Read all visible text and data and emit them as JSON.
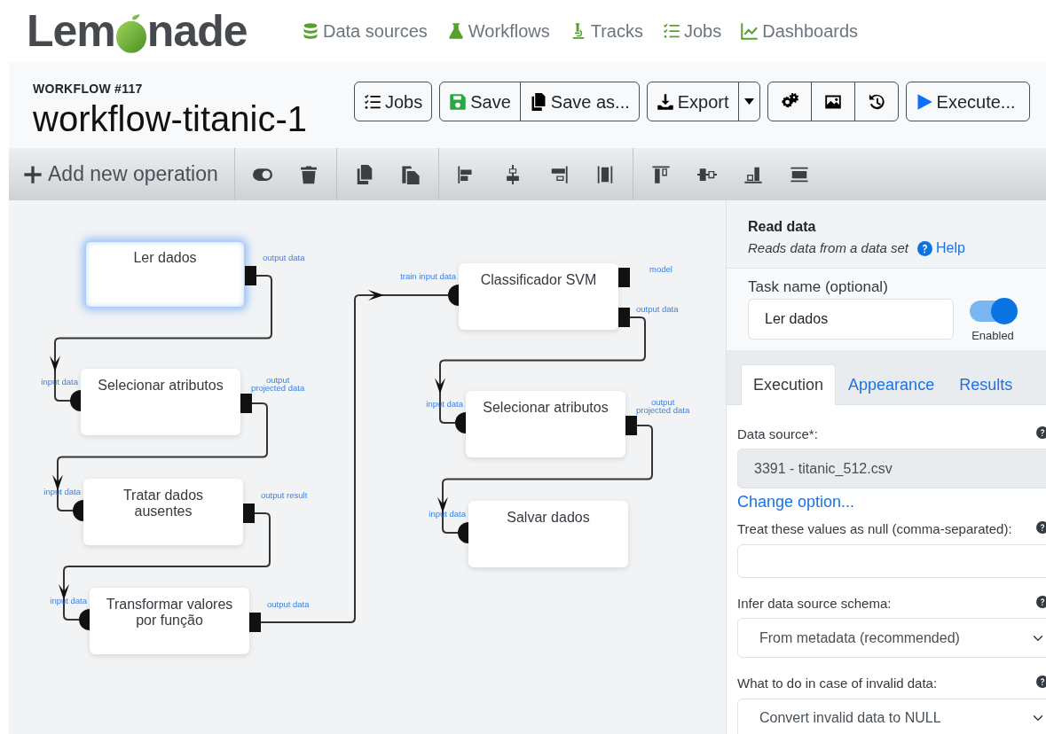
{
  "logo": {
    "before": "Lem",
    "after": "nade"
  },
  "nav": [
    {
      "label": "Data sources"
    },
    {
      "label": "Workflows"
    },
    {
      "label": "Tracks"
    },
    {
      "label": "Jobs"
    },
    {
      "label": "Dashboards"
    }
  ],
  "workflow": {
    "number": "WORKFLOW #117",
    "title": "workflow-titanic-1"
  },
  "button_groups": [
    [
      {
        "kind": "text",
        "label": "Jobs"
      }
    ],
    [
      {
        "kind": "text",
        "label": "Save"
      },
      {
        "kind": "text",
        "label": "Save as..."
      }
    ],
    [
      {
        "kind": "text",
        "label": "Export"
      },
      {
        "kind": "caret"
      }
    ],
    [
      {
        "kind": "icon"
      },
      {
        "kind": "icon"
      },
      {
        "kind": "icon"
      }
    ],
    [
      {
        "kind": "text",
        "label": "Execute..."
      }
    ]
  ],
  "editor_toolbar": {
    "add_label": "Add new operation"
  },
  "operations": [
    {
      "name": "Ler dados",
      "selected": true,
      "outputs": [
        "output data"
      ]
    },
    {
      "name": "Selecionar atributos",
      "selected": false,
      "inputs": [
        "input data"
      ],
      "outputs": [
        "output\nprojected data"
      ]
    },
    {
      "name": "Tratar dados ausentes",
      "selected": false,
      "inputs": [
        "input data"
      ],
      "outputs": [
        "output result"
      ]
    },
    {
      "name": "Transformar valores por função",
      "selected": false,
      "inputs": [
        "input data"
      ],
      "outputs": [
        "output data"
      ]
    },
    {
      "name": "Classificador SVM",
      "selected": false,
      "inputs": [
        "train input data"
      ],
      "outputs": [
        "model",
        "output data"
      ]
    },
    {
      "name": "Selecionar atributos",
      "selected": false,
      "inputs": [
        "input data"
      ],
      "outputs": [
        "output\nprojected data"
      ]
    },
    {
      "name": "Salvar dados",
      "selected": false,
      "inputs": [
        "input data"
      ]
    }
  ],
  "panel": {
    "title": "Read data",
    "description": "Reads data from a data set",
    "help": "Help",
    "task_name": {
      "label": "Task name (optional)",
      "value": "Ler dados"
    },
    "enabled": {
      "label": "Enabled",
      "on": true
    },
    "tabs": [
      {
        "label": "Execution",
        "selected": true
      },
      {
        "label": "Appearance",
        "selected": false
      },
      {
        "label": "Results",
        "selected": false
      }
    ],
    "fields": [
      {
        "kind": "readonly",
        "label": "Data source*:",
        "value": "3391 - titanic_512.csv",
        "link": "Change option..."
      },
      {
        "kind": "textarea",
        "label": "Treat these values as null (comma-separated):"
      },
      {
        "kind": "select",
        "label": "Infer data source schema:",
        "value": "From metadata (recommended)"
      },
      {
        "kind": "select",
        "label": "What to do in case of invalid data:",
        "value": "Convert invalid data to NULL"
      }
    ]
  }
}
